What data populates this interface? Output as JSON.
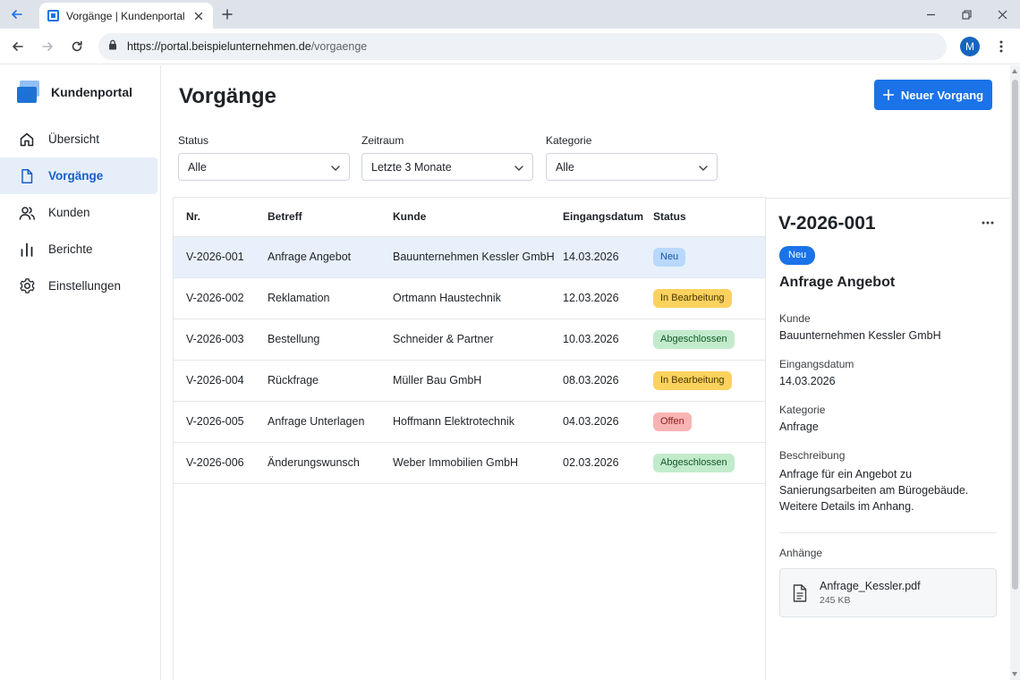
{
  "browser": {
    "tab_title": "Vorgänge | Kundenportal",
    "url_host": "https://portal.beispielunternehmen.de",
    "url_path": "/vorgaenge",
    "profile_initial": "M"
  },
  "sidebar": {
    "brand": "Kundenportal",
    "items": [
      {
        "label": "Übersicht",
        "icon": "home-icon",
        "active": false
      },
      {
        "label": "Vorgänge",
        "icon": "document-icon",
        "active": true
      },
      {
        "label": "Kunden",
        "icon": "users-icon",
        "active": false
      },
      {
        "label": "Berichte",
        "icon": "bar-chart-icon",
        "active": false
      },
      {
        "label": "Einstellungen",
        "icon": "gear-icon",
        "active": false
      }
    ]
  },
  "main": {
    "title": "Vorgänge",
    "new_button": "Neuer Vorgang",
    "filters": [
      {
        "label": "Status",
        "value": "Alle"
      },
      {
        "label": "Zeitraum",
        "value": "Letzte 3 Monate"
      },
      {
        "label": "Kategorie",
        "value": "Alle"
      }
    ]
  },
  "table": {
    "columns": [
      "Nr.",
      "Betreff",
      "Kunde",
      "Eingangsdatum",
      "Status"
    ],
    "rows": [
      {
        "nr": "V-2026-001",
        "betreff": "Anfrage Angebot",
        "kunde": "Bauunternehmen Kessler GmbH",
        "datum": "14.03.2026",
        "status": "Neu",
        "status_type": "neu",
        "selected": true
      },
      {
        "nr": "V-2026-002",
        "betreff": "Reklamation",
        "kunde": "Ortmann Haustechnik",
        "datum": "12.03.2026",
        "status": "In Bearbeitung",
        "status_type": "bearb",
        "selected": false
      },
      {
        "nr": "V-2026-003",
        "betreff": "Bestellung",
        "kunde": "Schneider & Partner",
        "datum": "10.03.2026",
        "status": "Abgeschlossen",
        "status_type": "abg",
        "selected": false
      },
      {
        "nr": "V-2026-004",
        "betreff": "Rückfrage",
        "kunde": "Müller Bau GmbH",
        "datum": "08.03.2026",
        "status": "In Bearbeitung",
        "status_type": "bearb",
        "selected": false
      },
      {
        "nr": "V-2026-005",
        "betreff": "Anfrage Unterlagen",
        "kunde": "Hoffmann Elektrotechnik",
        "datum": "04.03.2026",
        "status": "Offen",
        "status_type": "offen",
        "selected": false
      },
      {
        "nr": "V-2026-006",
        "betreff": "Änderungswunsch",
        "kunde": "Weber Immobilien GmbH",
        "datum": "02.03.2026",
        "status": "Abgeschlossen",
        "status_type": "abg",
        "selected": false
      }
    ]
  },
  "detail": {
    "id": "V-2026-001",
    "badge": "Neu",
    "title": "Anfrage Angebot",
    "kunde_label": "Kunde",
    "kunde": "Bauunternehmen Kessler GmbH",
    "datum_label": "Eingangsdatum",
    "datum": "14.03.2026",
    "kategorie_label": "Kategorie",
    "kategorie": "Anfrage",
    "beschreibung_label": "Beschreibung",
    "beschreibung_lines": [
      "Anfrage für ein Angebot zu",
      "Sanierungsarbeiten am Bürogebäude.",
      "Weitere Details im Anhang."
    ],
    "anhaenge_label": "Anhänge",
    "attachment_name": "Anfrage_Kessler.pdf",
    "attachment_size": "245 KB"
  },
  "colors": {
    "accent": "#1a73e8",
    "active_nav_bg": "#e6eefa",
    "selected_row_bg": "#e8f0fb",
    "badge_neu": "#b9d8fb",
    "badge_in_bearbeitung": "#fbd25e",
    "badge_abgeschlossen": "#c2ebcc",
    "badge_offen": "#f8b4b4"
  }
}
